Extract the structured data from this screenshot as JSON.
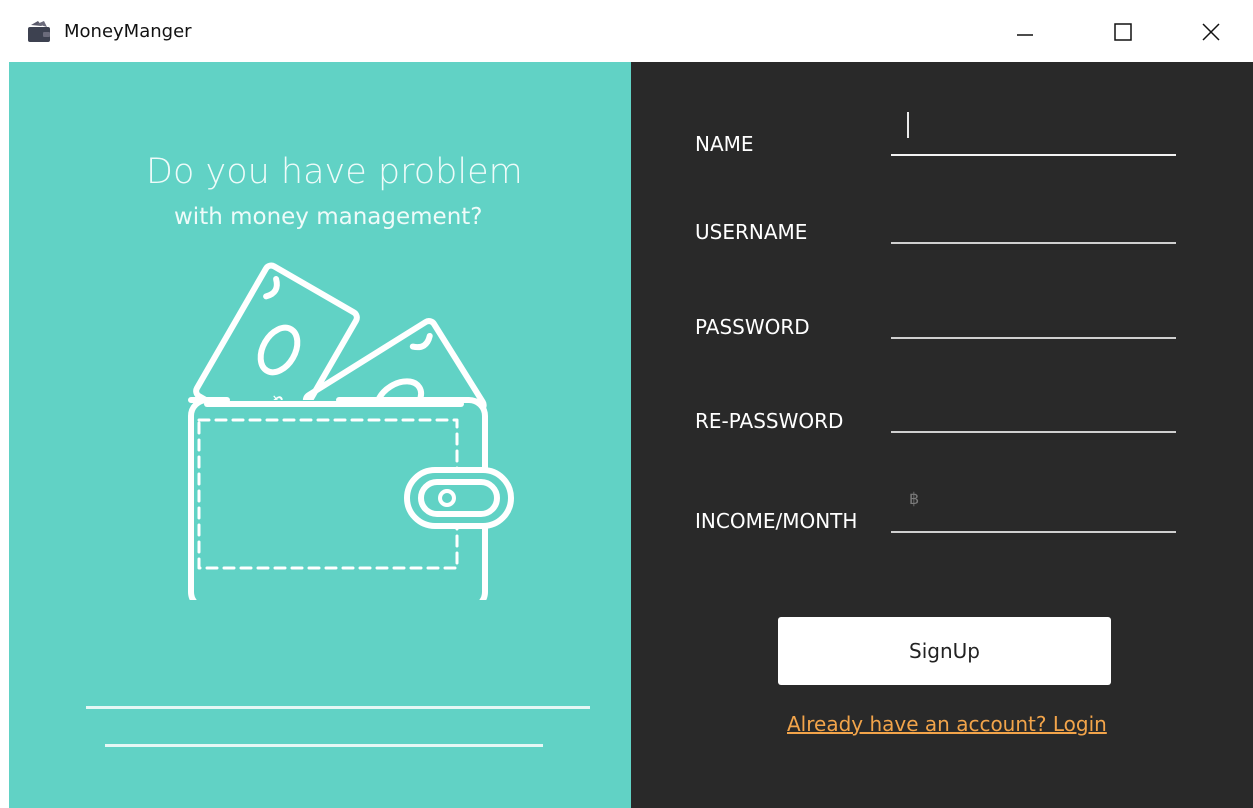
{
  "window": {
    "title": "MoneyManger",
    "icon": "wallet-icon"
  },
  "window_controls": {
    "minimize": "minimize-icon",
    "maximize": "maximize-icon",
    "close": "close-icon"
  },
  "hero": {
    "title": "Do you have problem",
    "subtitle": "with money management?",
    "bg_color": "#61d2c5",
    "illustration": "wallet-with-cash-icon"
  },
  "form": {
    "bg_color": "#292929",
    "fields": [
      {
        "label": "NAME",
        "value": ""
      },
      {
        "label": "USERNAME",
        "value": ""
      },
      {
        "label": "PASSWORD",
        "value": ""
      },
      {
        "label": "RE-PASSWORD",
        "value": ""
      },
      {
        "label": "INCOME/MONTH",
        "value": "",
        "prefix": "฿"
      }
    ],
    "signup_label": "SignUp",
    "login_link": "Already have an account? Login",
    "link_color": "#f2a44a"
  }
}
